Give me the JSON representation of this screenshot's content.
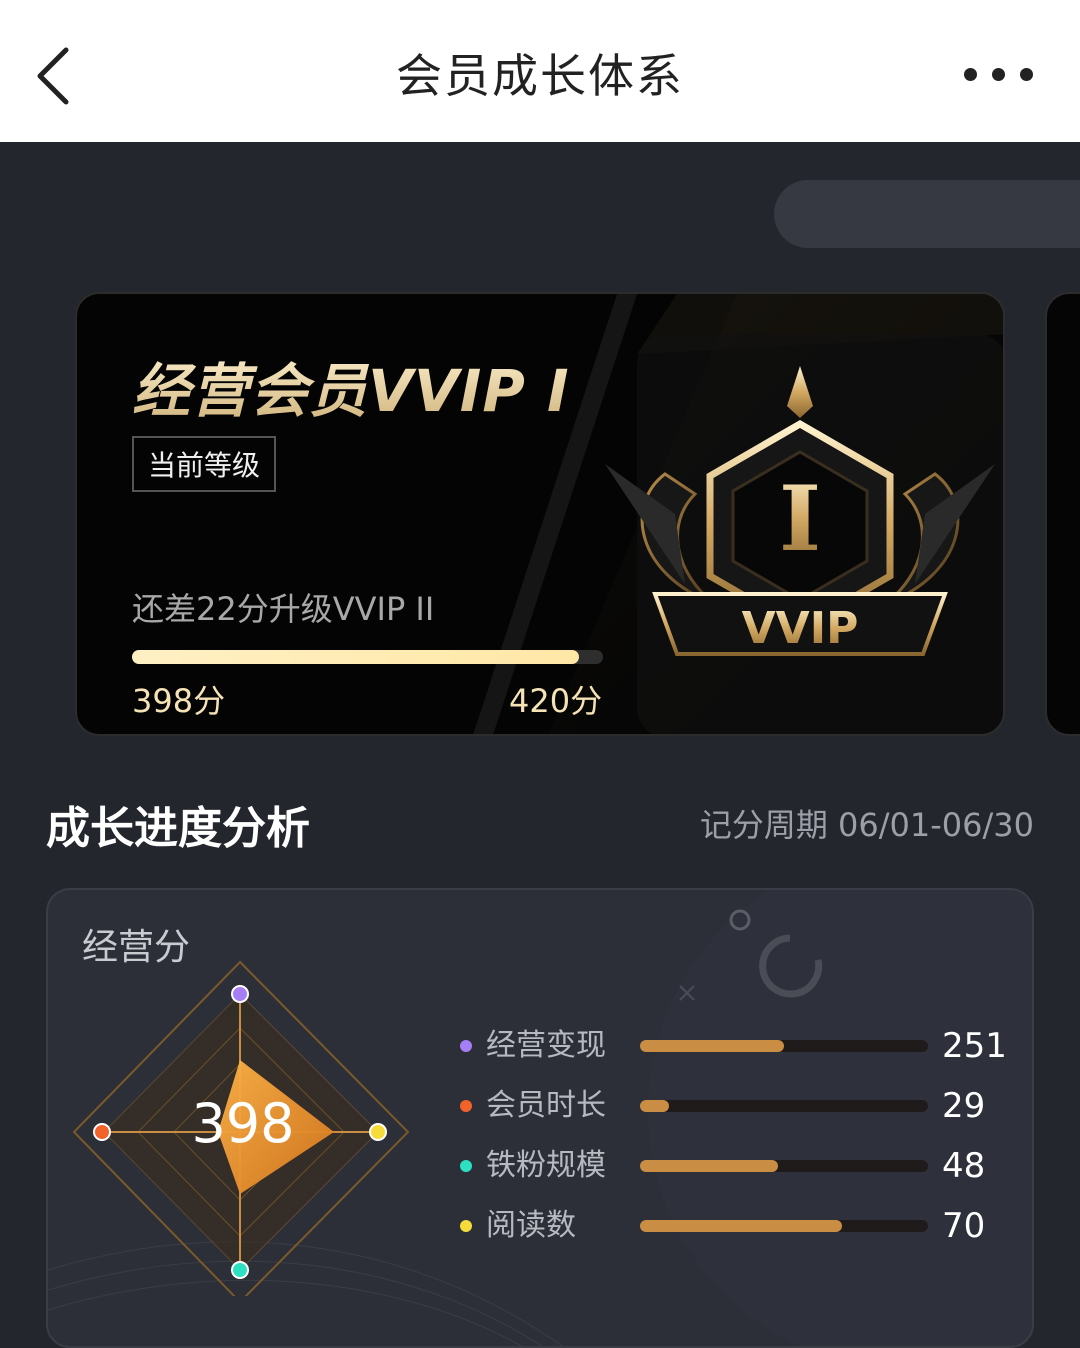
{
  "header": {
    "title": "会员成长体系"
  },
  "card": {
    "title": "经营会员VVIP I",
    "level_tag": "当前等级",
    "need_text": "还差22分升级VVIP II",
    "current_score_label": "398分",
    "next_score_label": "420分",
    "progress_fraction": 0.948,
    "badge": {
      "numeral": "I",
      "ribbon_text": "VVIP"
    }
  },
  "analysis": {
    "title": "成长进度分析",
    "period": "记分周期 06/01-06/30",
    "panel_title": "经营分",
    "total_score": "398",
    "metrics": [
      {
        "label": "经营变现",
        "value": "251",
        "fraction": 0.5,
        "dot_color": "#a67ef5"
      },
      {
        "label": "会员时长",
        "value": "29",
        "fraction": 0.1,
        "dot_color": "#f2622b"
      },
      {
        "label": "铁粉规模",
        "value": "48",
        "fraction": 0.48,
        "dot_color": "#2de0c2"
      },
      {
        "label": "阅读数",
        "value": "70",
        "fraction": 0.7,
        "dot_color": "#f5dc3a"
      }
    ]
  },
  "colors": {
    "accent_gold": "#f5e3b6",
    "bar_fill": "#c98d43",
    "background": "#24262d"
  }
}
